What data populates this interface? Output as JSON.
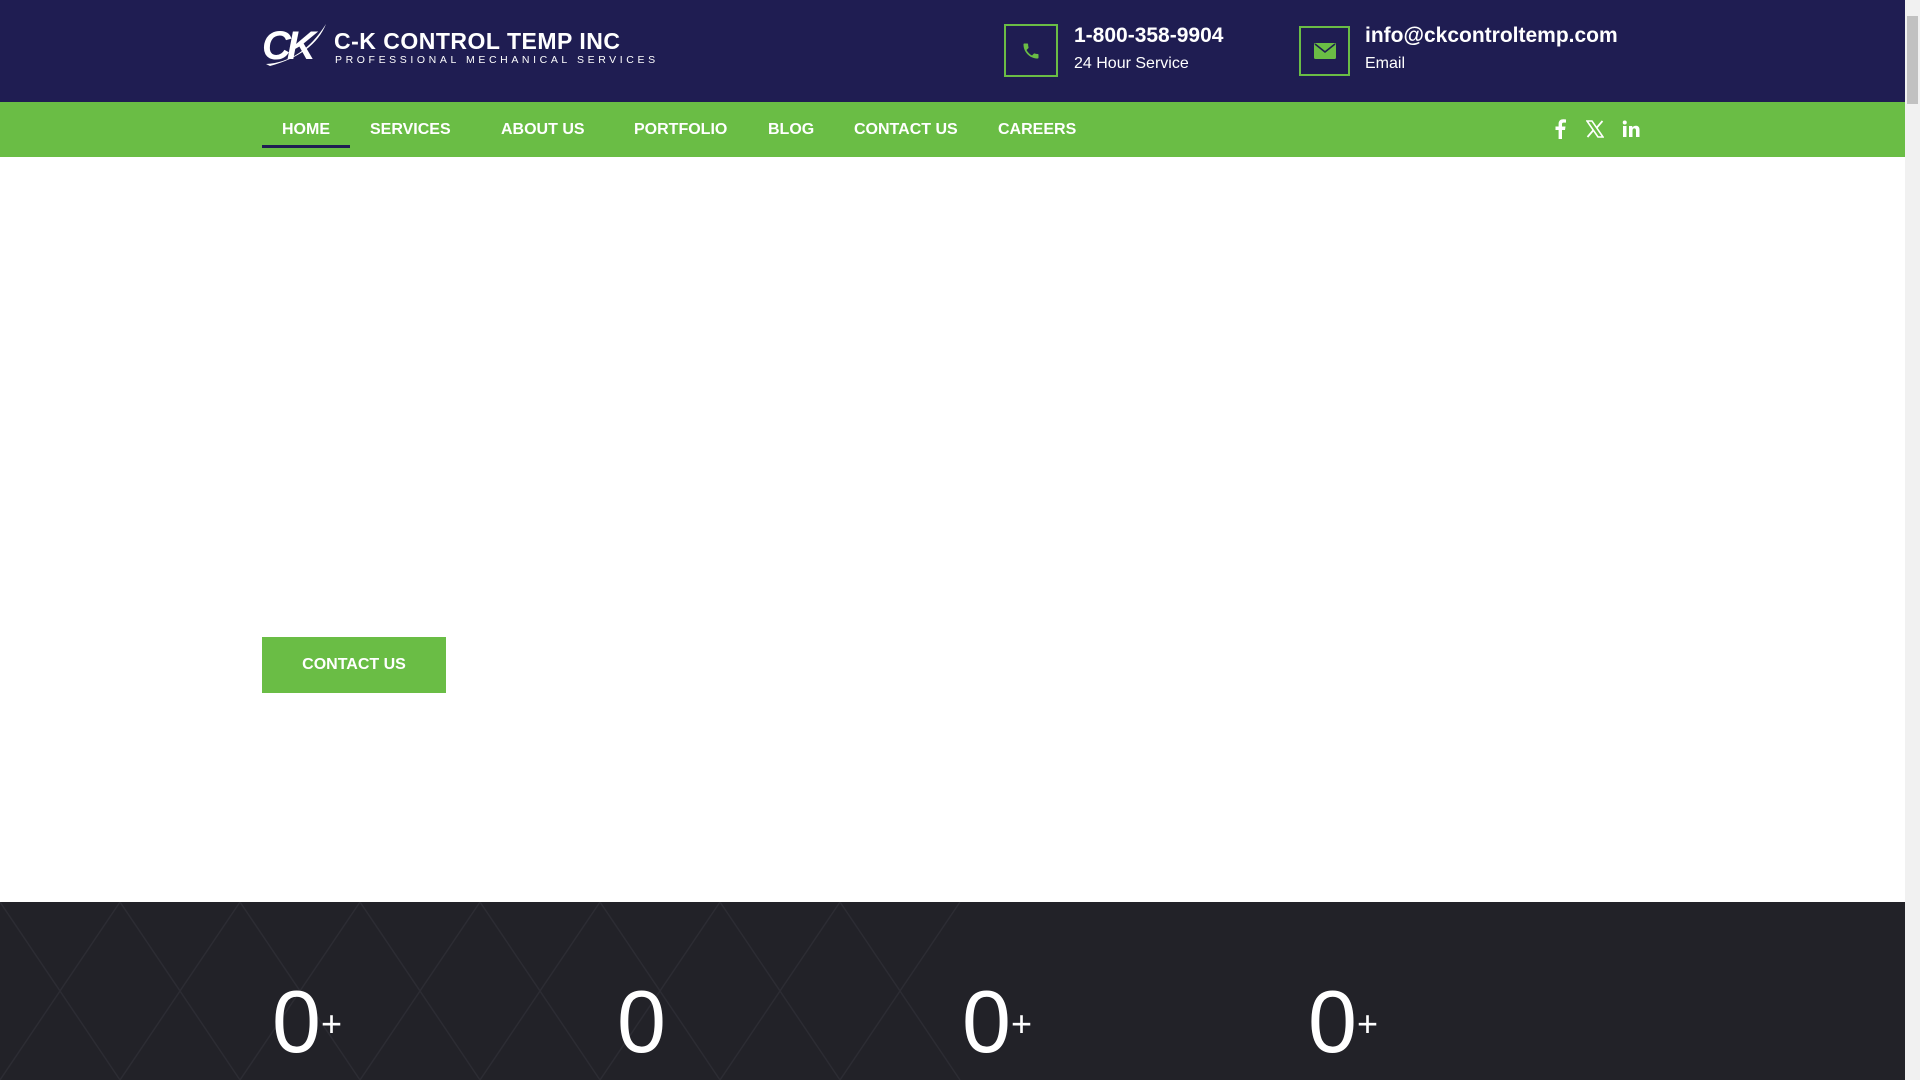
{
  "logo": {
    "mark": "CK",
    "name": "C-K CONTROL TEMP INC",
    "tagline": "PROFESSIONAL MECHANICAL SERVICES"
  },
  "contact": {
    "phone": {
      "title": "1-800-358-9904",
      "subtitle": "24 Hour Service",
      "icon": "phone-icon"
    },
    "email": {
      "title": "info@ckcontroltemp.com",
      "subtitle": "Email",
      "icon": "envelope-icon"
    }
  },
  "nav": {
    "items": [
      {
        "label": "HOME",
        "active": true
      },
      {
        "label": "SERVICES"
      },
      {
        "label": "ABOUT US"
      },
      {
        "label": "PORTFOLIO"
      },
      {
        "label": "BLOG"
      },
      {
        "label": "CONTACT US"
      },
      {
        "label": "CAREERS"
      }
    ]
  },
  "social": [
    "facebook-icon",
    "x-icon",
    "linkedin-icon"
  ],
  "hero": {
    "cta_label": "CONTACT US"
  },
  "stats": [
    {
      "value": "0",
      "suffix": "+"
    },
    {
      "value": "0",
      "suffix": ""
    },
    {
      "value": "0",
      "suffix": "+"
    },
    {
      "value": "0",
      "suffix": "+"
    }
  ],
  "colors": {
    "navy": "#1f1d52",
    "green": "#6abd45",
    "dark": "#222228"
  }
}
